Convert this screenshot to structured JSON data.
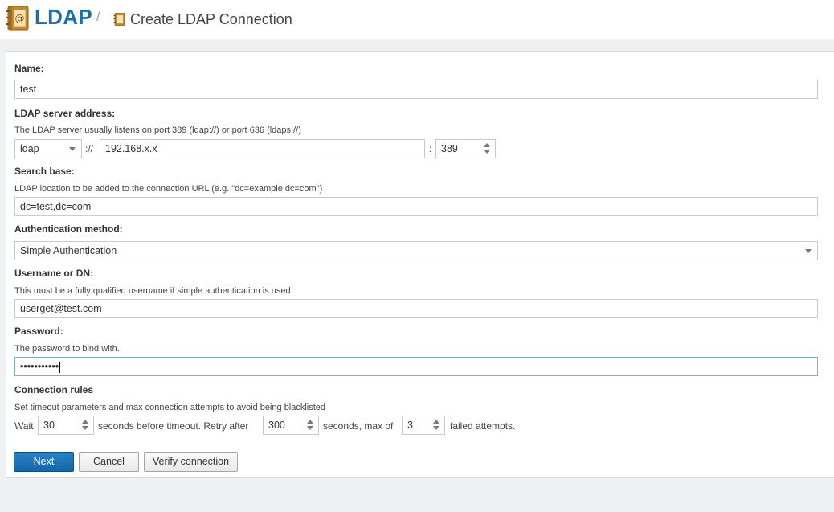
{
  "header": {
    "app_title": "LDAP",
    "separator": "/",
    "page_title": "Create LDAP Connection"
  },
  "form": {
    "name": {
      "label": "Name:",
      "value": "test"
    },
    "server": {
      "label": "LDAP server address:",
      "hint": "The LDAP server usually listens on port 389 (ldap://) or port 636 (ldaps://)",
      "protocol": "ldap",
      "scheme_sep": "://",
      "host": "192.168.x.x",
      "port_sep": ":",
      "port": "389"
    },
    "search_base": {
      "label": "Search base:",
      "hint": "LDAP location to be added to the connection URL (e.g. \"dc=example,dc=com\")",
      "value": "dc=test,dc=com"
    },
    "auth_method": {
      "label": "Authentication method:",
      "value": "Simple Authentication"
    },
    "username": {
      "label": "Username or DN:",
      "hint": "This must be a fully qualified username if simple authentication is used",
      "value": "userget@test.com"
    },
    "password": {
      "label": "Password:",
      "hint": "The password to bind with.",
      "masked_value": "•••••••••••"
    },
    "connection_rules": {
      "label": "Connection rules",
      "hint": "Set timeout parameters and max connection attempts to avoid being blacklisted",
      "wait_label": "Wait",
      "timeout": "30",
      "timeout_text": "seconds before timeout. Retry after",
      "retry": "300",
      "retry_text": "seconds, max of",
      "max_attempts": "3",
      "attempts_text": "failed attempts."
    }
  },
  "buttons": {
    "next": "Next",
    "cancel": "Cancel",
    "verify": "Verify connection"
  },
  "colors": {
    "accent": "#1a6fb3",
    "primary_button": "#1f74ba",
    "focus_border": "#7ab1d6"
  },
  "icons": {
    "app": "address-book-icon",
    "breadcrumb": "address-book-icon"
  }
}
